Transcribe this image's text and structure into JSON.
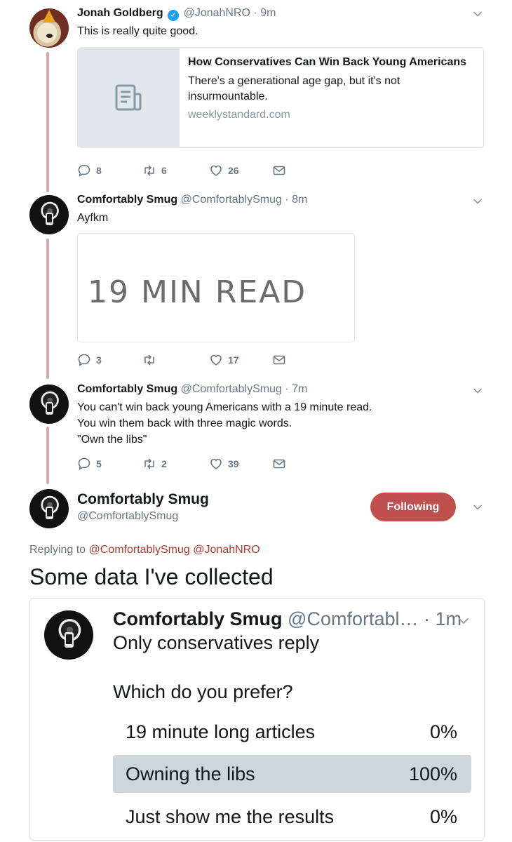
{
  "tweets": [
    {
      "name": "Jonah Goldberg",
      "handle": "@JonahNRO",
      "time": "· 9m",
      "verified": true,
      "text": "This is really quite good.",
      "card": {
        "title": "How Conservatives Can Win Back Young Americans",
        "description": "There's a generational age gap, but it's not insurmountable.",
        "domain": "weeklystandard.com"
      },
      "reply_count": "8",
      "retweet_count": "6",
      "like_count": "26"
    },
    {
      "name": "Comfortably Smug",
      "handle": "@ComfortablySmug",
      "time": "· 8m",
      "text": "Ayfkm",
      "media_text": "19 MIN READ",
      "reply_count": "3",
      "retweet_count": "",
      "like_count": "17"
    },
    {
      "name": "Comfortably Smug",
      "handle": "@ComfortablySmug",
      "time": "· 7m",
      "text_lines": [
        "You can't win back young Americans with a 19 minute read.",
        "You win them back with three magic words.",
        "\"Own the libs\""
      ],
      "reply_count": "5",
      "retweet_count": "2",
      "like_count": "39"
    }
  ],
  "main_tweet": {
    "name": "Comfortably Smug",
    "handle": "@ComfortablySmug",
    "follow_label": "Following",
    "replying_prefix": "Replying to",
    "replying_to_1": "@ComfortablySmug",
    "replying_to_2": "@JonahNRO",
    "text": "Some data I've collected",
    "quoted": {
      "name": "Comfortably Smug",
      "handle": "@Comfortabl…",
      "time": "· 1m",
      "text": "Only conservatives reply",
      "question": "Which do you prefer?",
      "options": [
        {
          "label": "19 minute long articles",
          "percent": "0%",
          "fraction": 0
        },
        {
          "label": "Owning the libs",
          "percent": "100%",
          "fraction": 1
        },
        {
          "label": "Just show me the results",
          "percent": "0%",
          "fraction": 0
        }
      ]
    }
  },
  "colors": {
    "thread_line": "#d6a9a6",
    "follow_button": "#c0504d",
    "link": "#b13a2f",
    "verified": "#1da1f2",
    "poll_fill": "#ccd6dd"
  }
}
